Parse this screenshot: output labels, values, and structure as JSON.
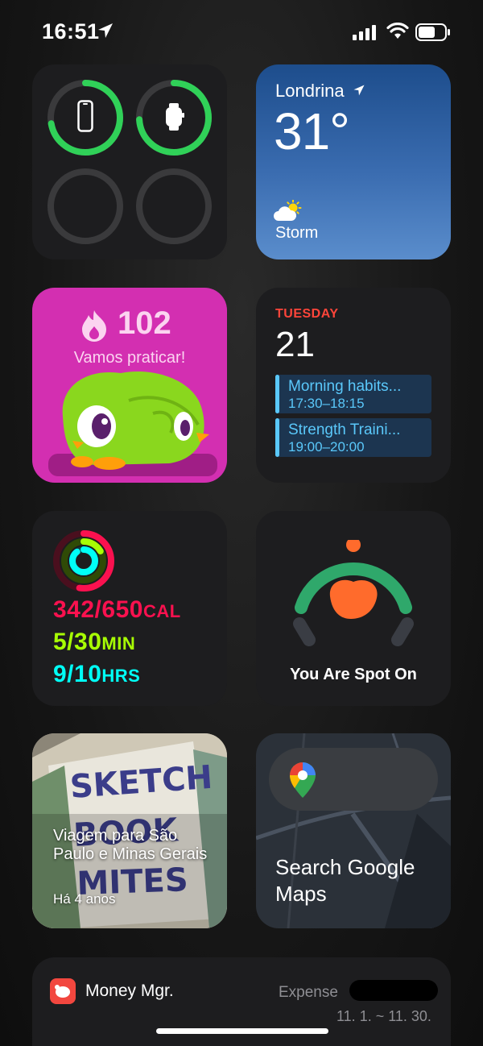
{
  "status_bar": {
    "time": "16:51"
  },
  "weather": {
    "city": "Londrina",
    "temperature": "31°",
    "condition": "Storm"
  },
  "duolingo": {
    "streak": "102",
    "message": "Vamos praticar!"
  },
  "calendar": {
    "day": "TUESDAY",
    "date": "21",
    "events": [
      {
        "title": "Morning habits...",
        "time": "17:30–18:15"
      },
      {
        "title": "Strength Traini...",
        "time": "19:00–20:00"
      }
    ]
  },
  "activity": {
    "move": {
      "value": "342/650",
      "unit": "CAL"
    },
    "exercise": {
      "value": "5/30",
      "unit": "MIN"
    },
    "stand": {
      "value": "9/10",
      "unit": "HRS"
    },
    "colors": {
      "move": "#fa114f",
      "exercise": "#a8ff04",
      "stand": "#00fff6"
    }
  },
  "sleep": {
    "label": "You Are Spot On"
  },
  "photos": {
    "caption": "Viagem para São Paulo e Minas Gerais",
    "age": "Há 4 anos"
  },
  "maps": {
    "label": "Search Google Maps"
  },
  "money": {
    "app_name": "Money Mgr.",
    "category": "Expense",
    "date_range": "11. 1. ~ 11. 30."
  }
}
